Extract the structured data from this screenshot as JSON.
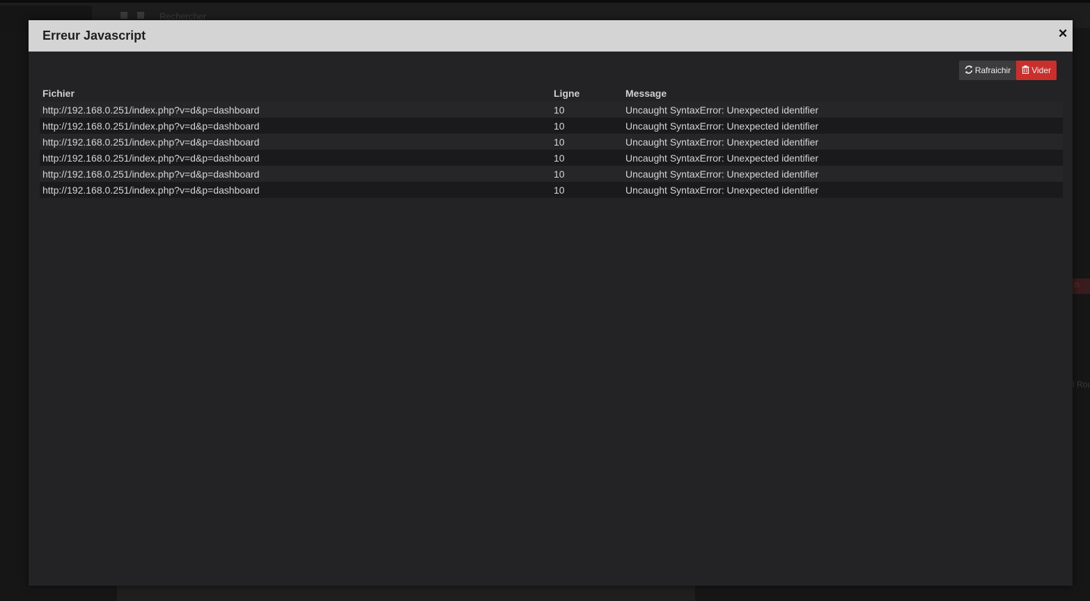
{
  "background": {
    "search_placeholder": "Rechercher",
    "right_badge_text": "n",
    "right_label_text": "l Rou"
  },
  "modal": {
    "title": "Erreur Javascript",
    "close_glyph": "×",
    "toolbar": {
      "refresh_label": "Rafraichir",
      "clear_label": "Vider",
      "refresh_icon": "refresh-icon",
      "clear_icon": "trash-icon"
    },
    "table": {
      "headers": {
        "file": "Fichier",
        "line": "Ligne",
        "message": "Message"
      },
      "rows": [
        {
          "file": "http://192.168.0.251/index.php?v=d&p=dashboard",
          "line": "10",
          "message": "Uncaught SyntaxError: Unexpected identifier"
        },
        {
          "file": "http://192.168.0.251/index.php?v=d&p=dashboard",
          "line": "10",
          "message": "Uncaught SyntaxError: Unexpected identifier"
        },
        {
          "file": "http://192.168.0.251/index.php?v=d&p=dashboard",
          "line": "10",
          "message": "Uncaught SyntaxError: Unexpected identifier"
        },
        {
          "file": "http://192.168.0.251/index.php?v=d&p=dashboard",
          "line": "10",
          "message": "Uncaught SyntaxError: Unexpected identifier"
        },
        {
          "file": "http://192.168.0.251/index.php?v=d&p=dashboard",
          "line": "10",
          "message": "Uncaught SyntaxError: Unexpected identifier"
        },
        {
          "file": "http://192.168.0.251/index.php?v=d&p=dashboard",
          "line": "10",
          "message": "Uncaught SyntaxError: Unexpected identifier"
        }
      ]
    }
  },
  "colors": {
    "header_bg": "#d4d4d4",
    "modal_bg": "#232325",
    "clear_button": "#c9302c",
    "refresh_button": "#3c3c3e"
  }
}
